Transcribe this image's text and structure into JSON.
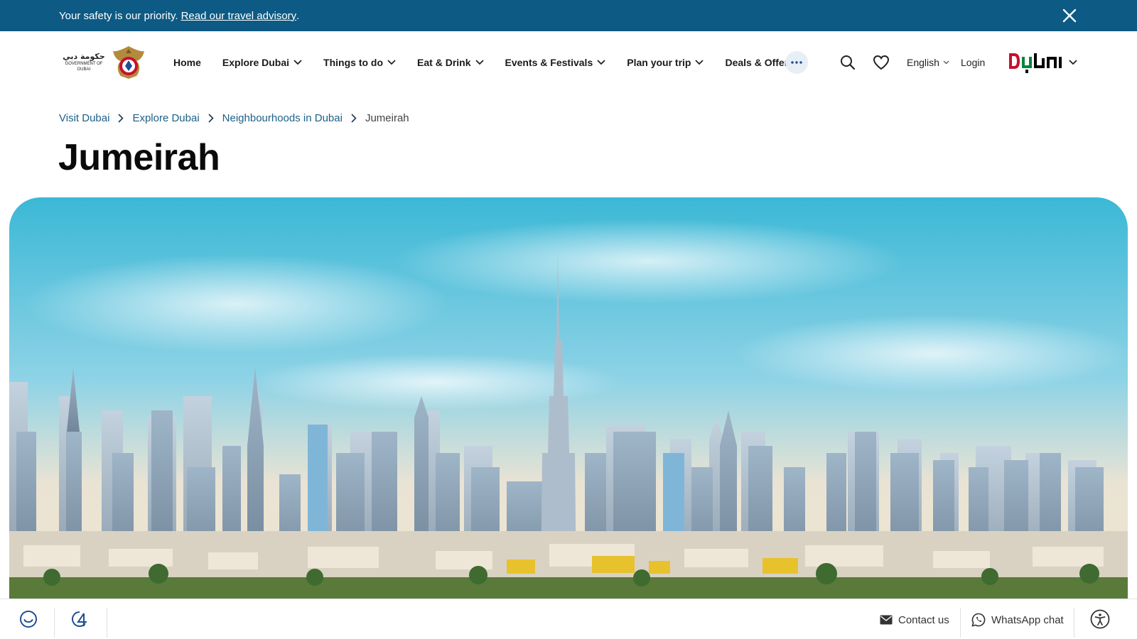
{
  "advisory": {
    "message": "Your safety is our priority.",
    "link_label": "Read our travel advisory",
    "link_suffix": "."
  },
  "gov_logo": {
    "arabic": "حكومة دبي",
    "english": "GOVERNMENT OF DUBAI"
  },
  "nav": {
    "items": [
      {
        "label": "Home",
        "has_dropdown": false
      },
      {
        "label": "Explore Dubai",
        "has_dropdown": true
      },
      {
        "label": "Things to do",
        "has_dropdown": true
      },
      {
        "label": "Eat & Drink",
        "has_dropdown": true
      },
      {
        "label": "Events & Festivals",
        "has_dropdown": true
      },
      {
        "label": "Plan your trip",
        "has_dropdown": true
      },
      {
        "label": "Deals & Offers",
        "has_dropdown": true
      }
    ],
    "more_icon": "more-dots-icon"
  },
  "utilities": {
    "search_icon": "search-icon",
    "favorites_icon": "heart-icon",
    "language": "English",
    "login": "Login"
  },
  "brand": {
    "logo_text": "DUBAI",
    "colors": {
      "red": "#c8102e",
      "green": "#00843d",
      "black": "#000000"
    }
  },
  "breadcrumb": [
    {
      "label": "Visit Dubai"
    },
    {
      "label": "Explore Dubai"
    },
    {
      "label": "Neighbourhoods in Dubai"
    },
    {
      "label": "Jumeirah",
      "current": true
    }
  ],
  "page_title": "Jumeirah",
  "footer_bar": {
    "contact_label": "Contact us",
    "whatsapp_label": "WhatsApp chat"
  },
  "colors": {
    "banner_bg": "#0d5a84",
    "link": "#1d5f87",
    "more_bg": "#e7eef6"
  }
}
